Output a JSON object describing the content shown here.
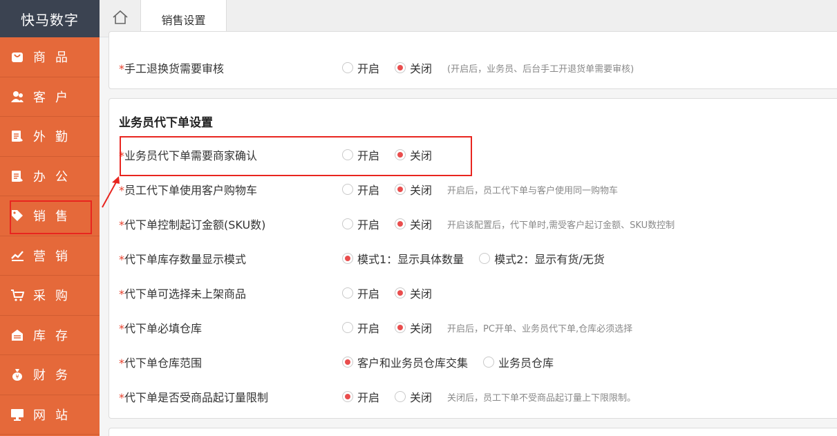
{
  "brand": "快马数字",
  "sidebar": {
    "items": [
      {
        "label": "商品",
        "icon": "bag-icon"
      },
      {
        "label": "客户",
        "icon": "users-icon"
      },
      {
        "label": "外勤",
        "icon": "clipboard-icon"
      },
      {
        "label": "办公",
        "icon": "clipboard-icon"
      },
      {
        "label": "销售",
        "icon": "tag-icon"
      },
      {
        "label": "营销",
        "icon": "chart-icon"
      },
      {
        "label": "采购",
        "icon": "cart-icon"
      },
      {
        "label": "库存",
        "icon": "warehouse-icon"
      },
      {
        "label": "财务",
        "icon": "moneybag-icon"
      },
      {
        "label": "网站",
        "icon": "monitor-icon"
      }
    ]
  },
  "tabs": {
    "active": "销售设置"
  },
  "card1": {
    "row": {
      "label": "手工退换货需要审核",
      "opt1": "开启",
      "opt2": "关闭",
      "hint": "(开启后，业务员、后台手工开退货单需要审核)"
    }
  },
  "card2": {
    "title": "业务员代下单设置",
    "rows": [
      {
        "label": "业务员代下单需要商家确认",
        "opt1": "开启",
        "opt2": "关闭",
        "hint": ""
      },
      {
        "label": "员工代下单使用客户购物车",
        "opt1": "开启",
        "opt2": "关闭",
        "hint": "开启后，员工代下单与客户使用同一购物车"
      },
      {
        "label": "代下单控制起订金额(SKU数)",
        "opt1": "开启",
        "opt2": "关闭",
        "hint": "开启该配置后，代下单时,需受客户起订金额、SKU数控制"
      },
      {
        "label": "代下单库存数量显示模式",
        "opt1": "模式1：显示具体数量",
        "opt2": "模式2：显示有货/无货",
        "hint": ""
      },
      {
        "label": "代下单可选择未上架商品",
        "opt1": "开启",
        "opt2": "关闭",
        "hint": ""
      },
      {
        "label": "代下单必填仓库",
        "opt1": "开启",
        "opt2": "关闭",
        "hint": "开启后，PC开单、业务员代下单,仓库必须选择"
      },
      {
        "label": "代下单仓库范围",
        "opt1": "客户和业务员仓库交集",
        "opt2": "业务员仓库",
        "hint": ""
      },
      {
        "label": "代下单是否受商品起订量限制",
        "opt1": "开启",
        "opt2": "关闭",
        "hint": "关闭后，员工下单不受商品起订量上下限限制。"
      }
    ]
  },
  "req_mark": "*",
  "colors": {
    "sidebar": "#e5693a",
    "brand_bg": "#3b4351",
    "accent": "#e94d4d",
    "highlight": "#e8251f"
  }
}
